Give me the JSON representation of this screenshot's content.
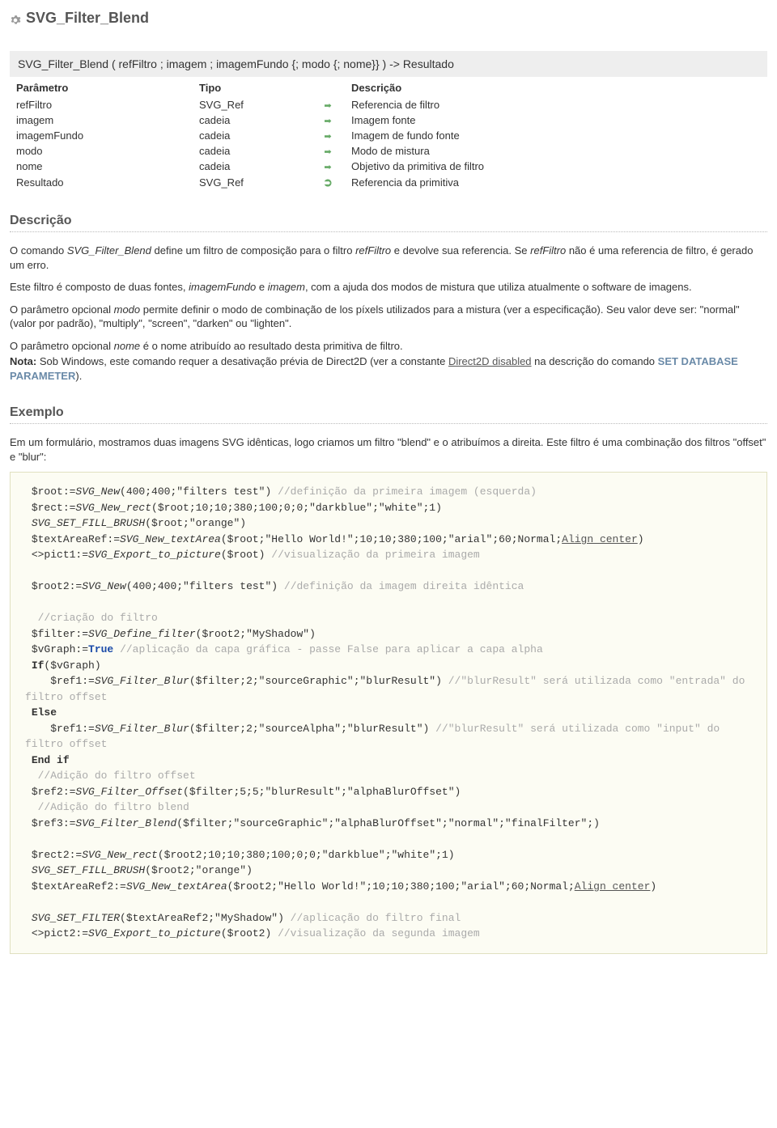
{
  "title": "SVG_Filter_Blend",
  "signature": "SVG_Filter_Blend ( refFiltro ; imagem ; imagemFundo {; modo {; nome}} ) -> Resultado",
  "paramTable": {
    "headers": {
      "p": "Parâmetro",
      "t": "Tipo",
      "d": "Descrição"
    },
    "rows": [
      {
        "p": "refFiltro",
        "t": "SVG_Ref",
        "dir": "in",
        "d": "Referencia de filtro"
      },
      {
        "p": "imagem",
        "t": "cadeia",
        "dir": "in",
        "d": "Imagem fonte"
      },
      {
        "p": "imagemFundo",
        "t": "cadeia",
        "dir": "in",
        "d": "Imagem de fundo fonte"
      },
      {
        "p": "modo",
        "t": "cadeia",
        "dir": "in",
        "d": "Modo de mistura"
      },
      {
        "p": "nome",
        "t": "cadeia",
        "dir": "in",
        "d": "Objetivo da primitiva de filtro"
      },
      {
        "p": "Resultado",
        "t": "SVG_Ref",
        "dir": "out",
        "d": "Referencia da primitiva"
      }
    ]
  },
  "sections": {
    "desc": "Descrição",
    "ex": "Exemplo"
  },
  "desc": {
    "p1a": "O comando ",
    "p1b": "SVG_Filter_Blend",
    "p1c": " define um filtro de composição para o filtro ",
    "p1d": "refFiltro",
    "p1e": " e devolve sua referencia. Se ",
    "p1f": "refFiltro",
    "p1g": " não é uma referencia de filtro, é gerado um erro.",
    "p2a": "Este filtro é composto de duas fontes, ",
    "p2b": "imagemFundo",
    "p2c": " e ",
    "p2d": "imagem",
    "p2e": ", com a ajuda dos modos de mistura que utiliza atualmente o software de imagens.",
    "p3a": "O parâmetro opcional ",
    "p3b": "modo",
    "p3c": " permite definir o modo de combinação de los píxels utilizados para a mistura (ver a especificação). Seu valor deve ser: \"normal\" (valor por padrão), \"multiply\", \"screen\", \"darken\" ou \"lighten\".",
    "p4a": "O parâmetro opcional ",
    "p4b": "nome",
    "p4c": " é o nome atribuído ao resultado desta primitiva de filtro.",
    "p5a": "Nota:",
    "p5b": " Sob Windows, este comando requer a desativação prévia de Direct2D (ver a constante ",
    "p5link": "Direct2D disabled",
    "p5c": " na descrição do comando ",
    "p5cmd": "SET DATABASE PARAMETER",
    "p5d": ")."
  },
  "example": {
    "intro": "Em um formulário, mostramos duas imagens SVG idênticas, logo criamos um filtro \"blend\" e o atribuímos a direita. Este filtro é uma combinação dos filtros  \"offset\" e \"blur\":",
    "code": {
      "l1a": " $root:=",
      "l1b": "SVG_New",
      "l1c": "(400;400;\"filters test\") ",
      "l1d": "//definição da primeira imagem (esquerda)",
      "l2a": " $rect:=",
      "l2b": "SVG_New_rect",
      "l2c": "($root;10;10;380;100;0;0;\"darkblue\";\"white\";1)",
      "l3a": " ",
      "l3b": "SVG_SET_FILL_BRUSH",
      "l3c": "($root;\"orange\")",
      "l4a": " $textAreaRef:=",
      "l4b": "SVG_New_textArea",
      "l4c": "($root;\"Hello World!\";10;10;380;100;\"arial\";60;Normal;",
      "l4d": "Align center",
      "l4e": ")",
      "l5a": " <>pict1:=",
      "l5b": "SVG_Export_to_picture",
      "l5c": "($root) ",
      "l5d": "//visualização da primeira imagem",
      "l6a": " $root2:=",
      "l6b": "SVG_New",
      "l6c": "(400;400;\"filters test\") ",
      "l6d": "//definição da imagem direita idêntica",
      "l7": "  //criação do filtro",
      "l8a": " $filter:=",
      "l8b": "SVG_Define_filter",
      "l8c": "($root2;\"MyShadow\")",
      "l9a": " $vGraph:=",
      "l9b": "True",
      "l9c": " ",
      "l9d": "//aplicação da capa gráfica - passe False para aplicar a capa alpha",
      "l10a": " ",
      "l10b": "If",
      "l10c": "($vGraph)",
      "l11a": "    $ref1:=",
      "l11b": "SVG_Filter_Blur",
      "l11c": "($filter;2;\"sourceGraphic\";\"blurResult\") ",
      "l11d": "//\"blurResult\" será utilizada como \"entrada\" do filtro offset",
      "l12a": " ",
      "l12b": "Else",
      "l13a": "    $ref1:=",
      "l13b": "SVG_Filter_Blur",
      "l13c": "($filter;2;\"sourceAlpha\";\"blurResult\") ",
      "l13d": "//\"blurResult\" será utilizada como \"input\" do filtro offset",
      "l14a": " ",
      "l14b": "End if",
      "l15": "  //Adição do filtro offset",
      "l16a": " $ref2:=",
      "l16b": "SVG_Filter_Offset",
      "l16c": "($filter;5;5;\"blurResult\";\"alphaBlurOffset\")",
      "l17": "  //Adição do filtro blend",
      "l18a": " $ref3:=",
      "l18b": "SVG_Filter_Blend",
      "l18c": "($filter;\"sourceGraphic\";\"alphaBlurOffset\";\"normal\";\"finalFilter\";)",
      "l19a": " $rect2:=",
      "l19b": "SVG_New_rect",
      "l19c": "($root2;10;10;380;100;0;0;\"darkblue\";\"white\";1)",
      "l20a": " ",
      "l20b": "SVG_SET_FILL_BRUSH",
      "l20c": "($root2;\"orange\")",
      "l21a": " $textAreaRef2:=",
      "l21b": "SVG_New_textArea",
      "l21c": "($root2;\"Hello World!\";10;10;380;100;\"arial\";60;Normal;",
      "l21d": "Align center",
      "l21e": ")",
      "l22a": " ",
      "l22b": "SVG_SET_FILTER",
      "l22c": "($textAreaRef2;\"MyShadow\") ",
      "l22d": "//aplicação do filtro final",
      "l23a": " <>pict2:=",
      "l23b": "SVG_Export_to_picture",
      "l23c": "($root2) ",
      "l23d": "//visualização da segunda imagem"
    }
  }
}
